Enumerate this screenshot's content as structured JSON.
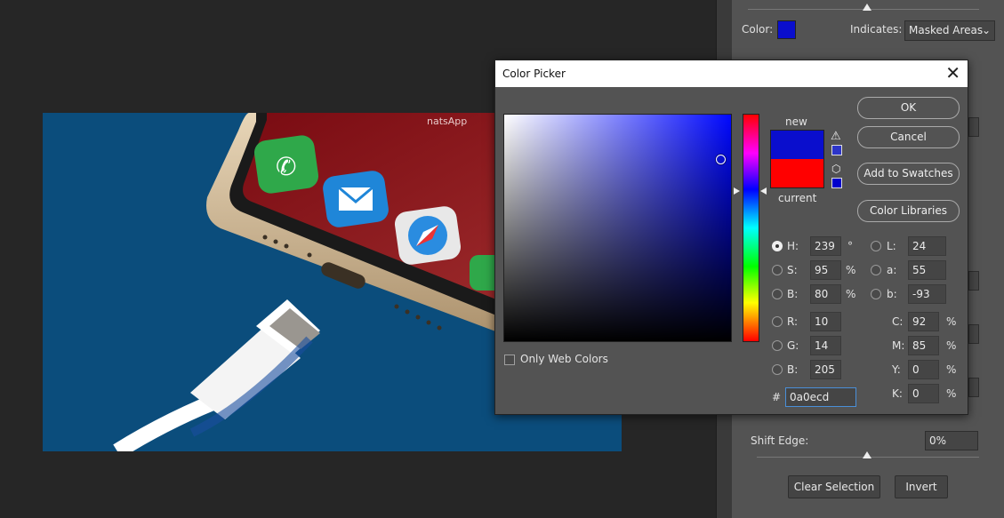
{
  "right_panel": {
    "color_label": "Color:",
    "color_swatch": "#0a0ecd",
    "indicates_label": "Indicates:",
    "indicates_value": "Masked Areas",
    "shift_edge_label": "Shift Edge:",
    "shift_edge_value": "0%",
    "clear_selection": "Clear Selection",
    "invert": "Invert"
  },
  "dialog": {
    "title": "Color Picker",
    "new_label": "new",
    "current_label": "current",
    "new_color": "#0a0ecd",
    "current_color": "#ff0000",
    "ok": "OK",
    "cancel": "Cancel",
    "add_to_swatches": "Add to Swatches",
    "color_libraries": "Color Libraries",
    "only_web_colors": "Only Web Colors",
    "hue_color": "#0008ff",
    "fields": {
      "h": {
        "label": "H:",
        "value": "239",
        "unit": "°"
      },
      "s": {
        "label": "S:",
        "value": "95",
        "unit": "%"
      },
      "b": {
        "label": "B:",
        "value": "80",
        "unit": "%"
      },
      "r": {
        "label": "R:",
        "value": "10"
      },
      "g": {
        "label": "G:",
        "value": "14"
      },
      "b2": {
        "label": "B:",
        "value": "205"
      },
      "l": {
        "label": "L:",
        "value": "24"
      },
      "a": {
        "label": "a:",
        "value": "55"
      },
      "lab_b": {
        "label": "b:",
        "value": "-93"
      },
      "c": {
        "label": "C:",
        "value": "92",
        "unit": "%"
      },
      "m": {
        "label": "M:",
        "value": "85",
        "unit": "%"
      },
      "y": {
        "label": "Y:",
        "value": "0",
        "unit": "%"
      },
      "k": {
        "label": "K:",
        "value": "0",
        "unit": "%"
      }
    },
    "hex_label": "#",
    "hex_value": "0a0ecd"
  },
  "photo": {
    "watermark": "natsApp"
  }
}
